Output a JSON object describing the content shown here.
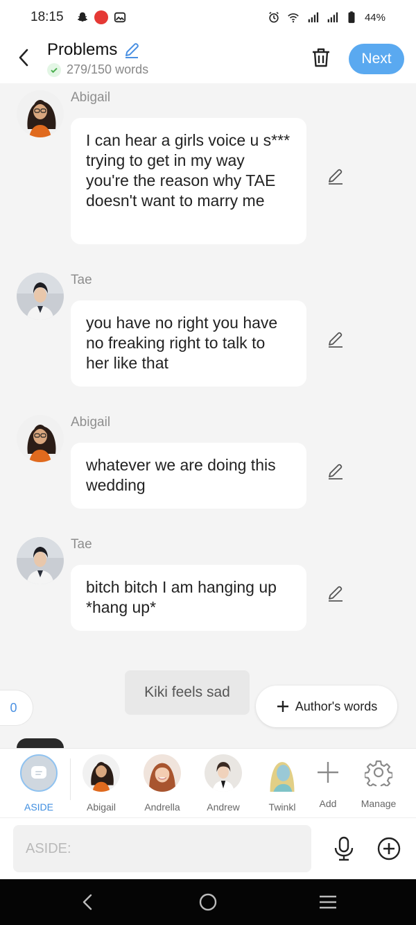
{
  "status_bar": {
    "time": "18:15",
    "battery": "44%"
  },
  "header": {
    "title": "Problems",
    "word_count": "279/150 words",
    "next_label": "Next"
  },
  "messages": [
    {
      "sender": "Abigail",
      "text": "I can hear a girls voice u s*** trying to get in my way you're the reason why TAE doesn't want to marry me"
    },
    {
      "sender": "Tae",
      "text": "you have no right you have no freaking right to talk to her like that"
    },
    {
      "sender": "Abigail",
      "text": "whatever we are doing this  wedding"
    },
    {
      "sender": "Tae",
      "text": "bitch bitch I am hanging up *hang up*"
    }
  ],
  "narration": "Kiki feels sad",
  "counter": "0",
  "author_words_label": "Author's words",
  "characters": [
    {
      "label": "ASIDE"
    },
    {
      "label": "Abigail"
    },
    {
      "label": "Andrella"
    },
    {
      "label": "Andrew"
    },
    {
      "label": "Twinkl"
    }
  ],
  "tools": {
    "add_label": "Add",
    "manage_label": "Manage"
  },
  "input": {
    "placeholder": "ASIDE:"
  },
  "colors": {
    "accent": "#5aa9f0",
    "aside_label": "#3f8ee0",
    "check": "#4caf50"
  }
}
